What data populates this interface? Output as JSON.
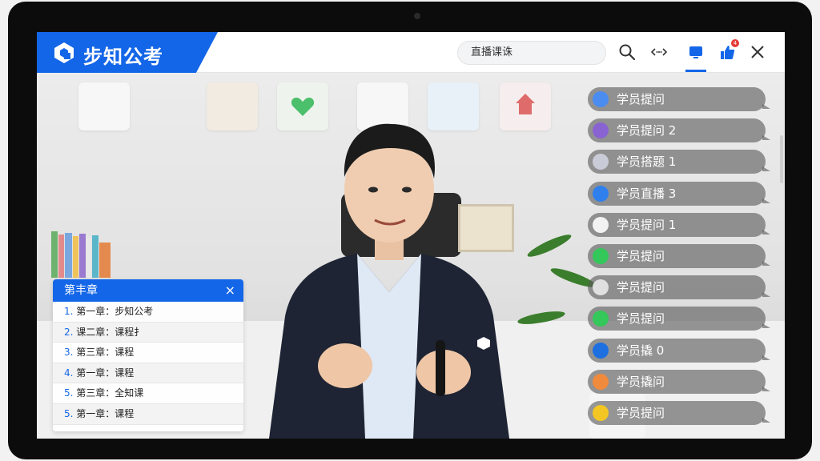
{
  "brand": {
    "name": "步知公考"
  },
  "search": {
    "value": "直播课诛"
  },
  "header": {
    "icons": [
      "search-icon",
      "code-icon",
      "live-icon",
      "like-icon",
      "close-icon"
    ],
    "like_badge": "4"
  },
  "chapters": {
    "title": "第丰章",
    "close": "×",
    "items": [
      {
        "num": "1.",
        "text": "第一章：步知公考"
      },
      {
        "num": "2.",
        "text": "课二章：课程扌"
      },
      {
        "num": "3.",
        "text": "第三章：课程"
      },
      {
        "num": "4.",
        "text": "第一章：课程"
      },
      {
        "num": "5.",
        "text": "第三章：全知课"
      },
      {
        "num": "5.",
        "text": "第一章：课程"
      }
    ]
  },
  "comments": [
    {
      "text": "学员提问",
      "color": "#4a8cf0"
    },
    {
      "text": "学员提问 2",
      "color": "#8a63d2"
    },
    {
      "text": "学员搭题 1",
      "color": "#c9cbd6"
    },
    {
      "text": "学员直播 3",
      "color": "#2f80ed"
    },
    {
      "text": "学员提问 1",
      "color": "#f2f2f2"
    },
    {
      "text": "学员提问",
      "color": "#34c759"
    },
    {
      "text": "学员提问",
      "color": "#e0e0e0"
    },
    {
      "text": "学员提问",
      "color": "#34c759"
    },
    {
      "text": "学员撬 0",
      "color": "#1e6fe0"
    },
    {
      "text": "学员撬问",
      "color": "#f08a3c"
    },
    {
      "text": "学员提问",
      "color": "#f3c623"
    }
  ],
  "colors": {
    "brand": "#1466e8",
    "badge": "#e53935"
  }
}
